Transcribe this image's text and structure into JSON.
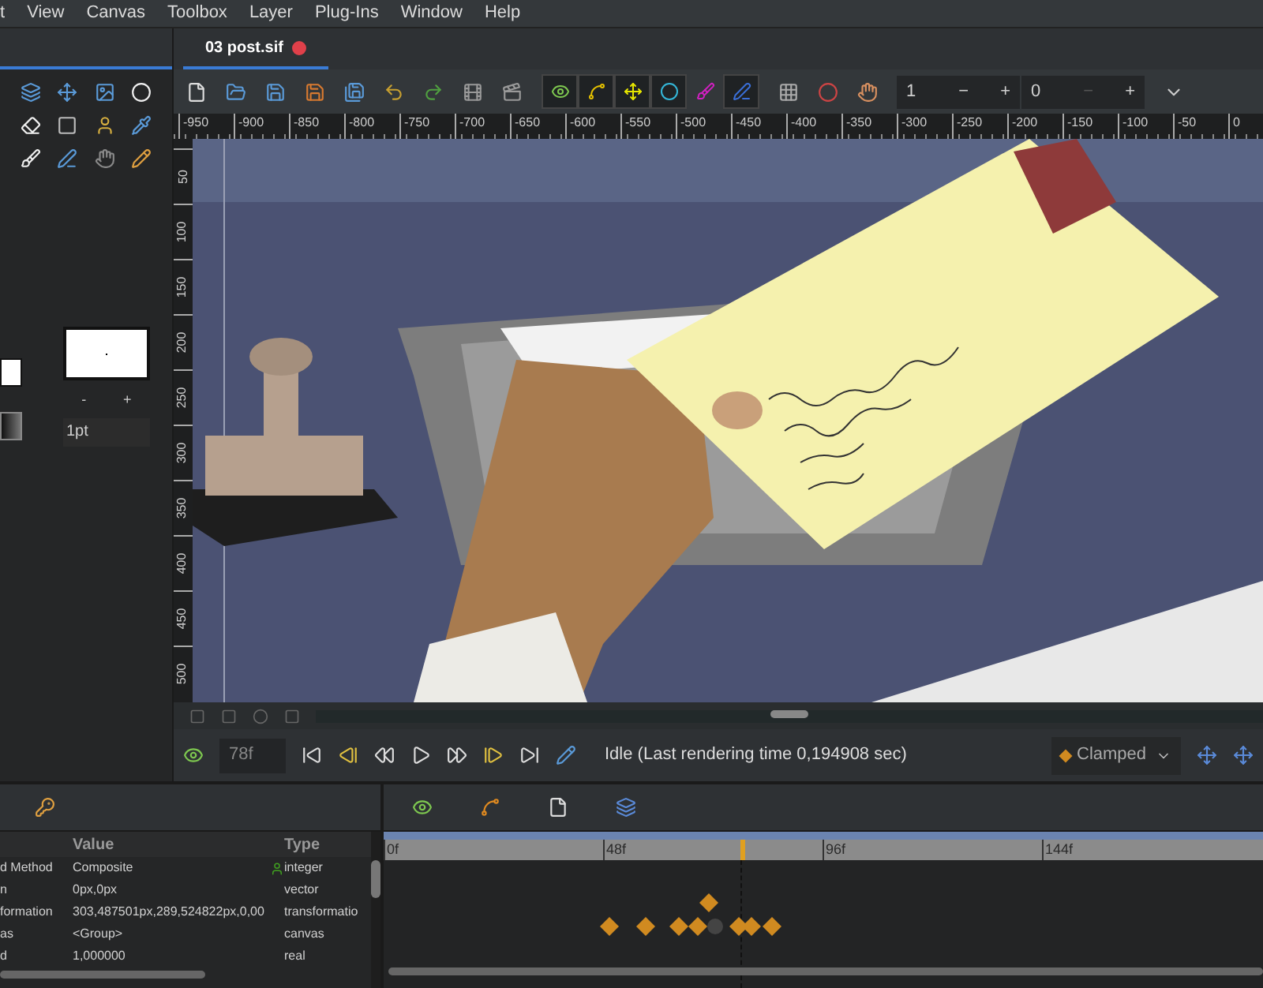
{
  "menu": [
    "t",
    "View",
    "Canvas",
    "Toolbox",
    "Layer",
    "Plug-Ins",
    "Window",
    "Help"
  ],
  "document_tabs": [
    {
      "label": "03 post.sif",
      "selected": true
    }
  ],
  "toolbar": {
    "toggles": [
      {
        "on": true
      },
      {
        "on": true
      },
      {
        "on": true
      },
      {
        "on": true
      },
      {
        "on": false
      },
      {
        "on": true
      }
    ],
    "zoom_value": "1",
    "zoom_minus": "−",
    "zoom_plus": "+",
    "offset_value": "0",
    "offset_minus": "−",
    "offset_plus": "+"
  },
  "ruler_h": [
    "-950",
    "-900",
    "-850",
    "-800",
    "-750",
    "-700",
    "-650",
    "-600",
    "-550",
    "-500",
    "-450",
    "-400",
    "-350",
    "-300",
    "-250",
    "-200",
    "-150",
    "-100",
    "-50",
    "0"
  ],
  "ruler_v": [
    "50",
    "100",
    "150",
    "200",
    "250",
    "300",
    "350",
    "400",
    "450",
    "500"
  ],
  "brush": {
    "minus": "-",
    "plus": "+",
    "size": "1pt"
  },
  "timebar": {
    "frame": "78f",
    "status": "Idle (Last rendering time 0,194908 sec)",
    "interpolation": "Clamped"
  },
  "params": {
    "columns": [
      "Value",
      "Type"
    ],
    "rows": [
      {
        "name": "d Method",
        "value": "Composite",
        "type": "integer",
        "marker": true
      },
      {
        "name": "n",
        "value": "0px,0px",
        "type": "vector",
        "marker": false
      },
      {
        "name": "formation",
        "value": "303,487501px,289,524822px,0,00",
        "type": "transformatio",
        "marker": false
      },
      {
        "name": "as",
        "value": "<Group>",
        "type": "canvas",
        "marker": false
      },
      {
        "name": "d",
        "value": "1,000000",
        "type": "real",
        "marker": false
      }
    ]
  },
  "timeline": {
    "ticks": [
      "0f",
      "48f",
      "96f",
      "144f"
    ],
    "level": 0.406
  }
}
